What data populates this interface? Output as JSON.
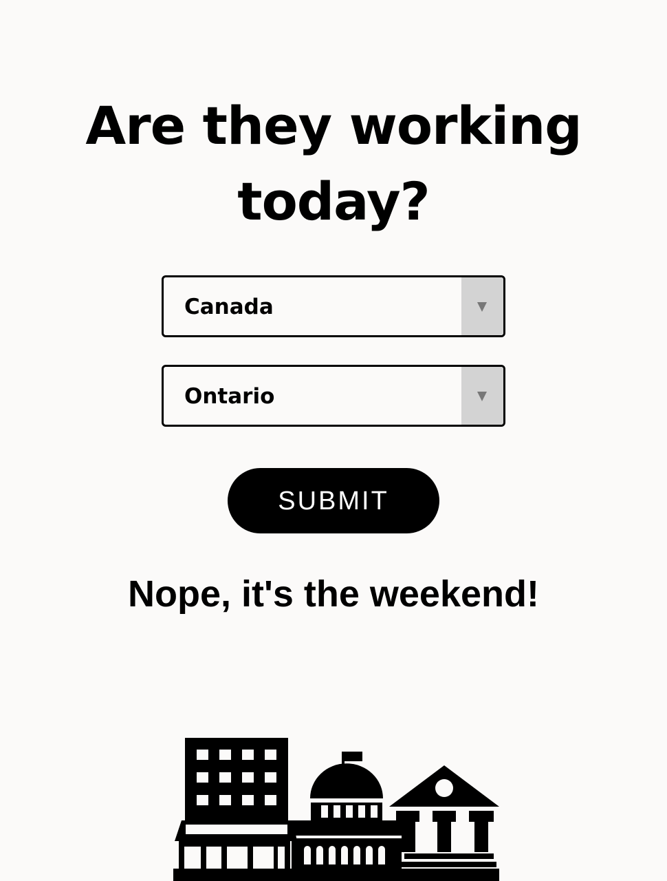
{
  "heading": "Are they working today?",
  "country_select": {
    "selected": "Canada"
  },
  "region_select": {
    "selected": "Ontario"
  },
  "submit_label": "SUBMIT",
  "result_text": "Nope, it's the weekend!",
  "colors": {
    "background": "#fbfaf9",
    "foreground": "#000000",
    "dropdown_arrow_bg": "#d3d3d3",
    "dropdown_arrow": "#777777"
  },
  "icons": [
    "chevron-down-icon",
    "government-buildings-illustration"
  ]
}
